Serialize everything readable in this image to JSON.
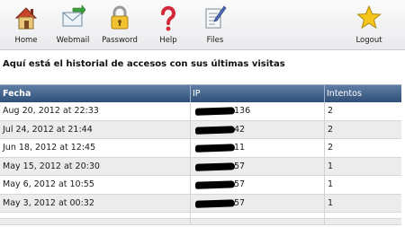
{
  "toolbar": {
    "items": [
      {
        "label": "Home",
        "icon": "home-icon"
      },
      {
        "label": "Webmail",
        "icon": "webmail-icon"
      },
      {
        "label": "Password",
        "icon": "lock-icon"
      },
      {
        "label": "Help",
        "icon": "help-icon"
      },
      {
        "label": "Files",
        "icon": "files-icon"
      },
      {
        "label": "Logout",
        "icon": "star-icon"
      }
    ]
  },
  "heading": "Aquí está el historial de accesos con sus últimas visitas",
  "table": {
    "columns": [
      "Fecha",
      "IP",
      "Intentos"
    ],
    "rows": [
      {
        "fecha": "Aug 20, 2012 at 22:33",
        "ip_tail": "136",
        "intentos": "2"
      },
      {
        "fecha": "Jul 24, 2012 at 21:44",
        "ip_tail": "42",
        "intentos": "2"
      },
      {
        "fecha": "Jun 18, 2012 at 12:45",
        "ip_tail": "11",
        "intentos": "2"
      },
      {
        "fecha": "May 15, 2012 at 20:30",
        "ip_tail": "57",
        "intentos": "1"
      },
      {
        "fecha": "May 6, 2012 at 10:55",
        "ip_tail": "57",
        "intentos": "1"
      },
      {
        "fecha": "May 3, 2012 at 00:32",
        "ip_tail": "57",
        "intentos": "1"
      }
    ]
  },
  "colors": {
    "header_top": "#5f7ea4",
    "header_bottom": "#2f4f78",
    "row_alt": "#ececec",
    "redaction": "#000000"
  }
}
